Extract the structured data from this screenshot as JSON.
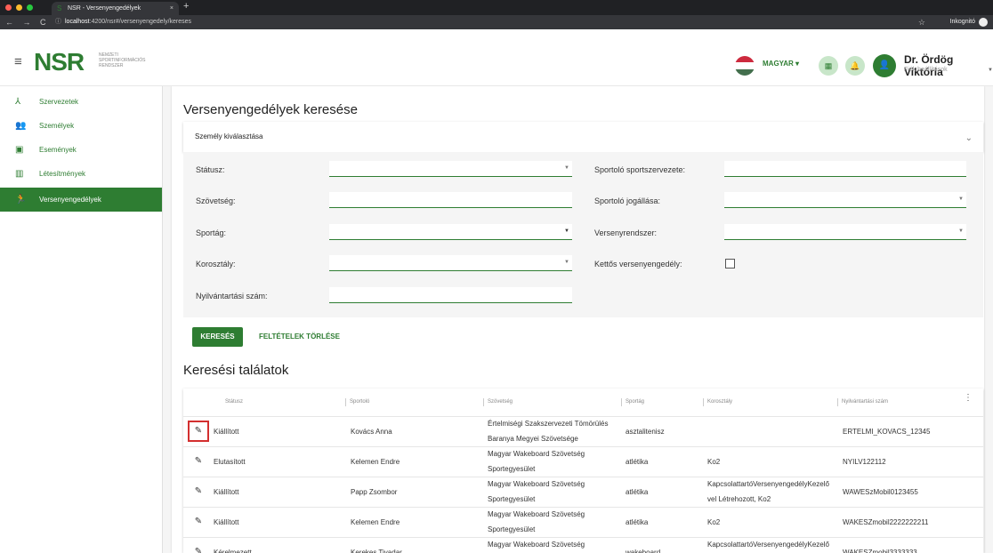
{
  "browser": {
    "tab_title": "NSR - Versenyengedélyek",
    "tab_close": "×",
    "new_tab": "+",
    "nav_icons": "← → C",
    "url_host": "localhost",
    "url_path": ":4200/nsr#/versenyengedely/kereses",
    "star": "☆",
    "incognito": "Inkognitó"
  },
  "header": {
    "menu": "≡",
    "logo": "NSR",
    "logo_sub_1": "Nemzeti",
    "logo_sub_2": "Sportinformációs",
    "logo_sub_3": "Rendszer",
    "language": "MAGYAR ▾",
    "user_name": "Dr. Ördög Viktória",
    "user_sub": "Fiók beállítások",
    "user_caret": "▼",
    "brand_color": "#2e7d32"
  },
  "sidebar": {
    "items": [
      {
        "label": "Szervezetek",
        "icon": "⅄"
      },
      {
        "label": "Személyek",
        "icon": "👥"
      },
      {
        "label": "Események",
        "icon": "▣"
      },
      {
        "label": "Létesítmények",
        "icon": "▥"
      },
      {
        "label": "Versenyengedélyek",
        "icon": "🏃"
      }
    ]
  },
  "main": {
    "page_title": "Versenyengedélyek keresése",
    "expander": "Személy kiválasztása",
    "expander_icon": "⌄",
    "form": {
      "status": "Státusz:",
      "federation": "Szövetség:",
      "sport": "Sportág:",
      "age_group": "Korosztály:",
      "reg_number": "Nyilvántartási szám:",
      "athlete_org": "Sportoló sportszervezete:",
      "athlete_status": "Sportoló jogállása:",
      "competition_system": "Versenyrendszer:",
      "dual_license": "Kettős versenyengedély:"
    },
    "search_button": "KERESÉS",
    "clear_button": "FELTÉTELEK TÖRLÉSE",
    "results_title": "Keresési találatok",
    "columns": [
      "Státusz",
      "Sportoló",
      "Szövetség",
      "Sportág",
      "Korosztály",
      "Nyilvántartási szám"
    ],
    "kebab": "⋮",
    "edit_icon": "✎",
    "rows": [
      {
        "status": "Kiállított",
        "athlete": "Kovács Anna",
        "fed1": "Értelmiségi Szakszervezeti Tömörülés",
        "fed2": "Baranya Megyei Szövetsége",
        "sport": "asztalitenisz",
        "age1": "",
        "age2": "",
        "reg": "ERTELMI_KOVACS_12345"
      },
      {
        "status": "Elutasított",
        "athlete": "Kelemen Endre",
        "fed1": "Magyar Wakeboard Szövetség",
        "fed2": "Sportegyesület",
        "sport": "atlétika",
        "age1": "Ko2",
        "age2": "",
        "reg": "NYILV122112"
      },
      {
        "status": "Kiállított",
        "athlete": "Papp Zsombor",
        "fed1": "Magyar Wakeboard Szövetség",
        "fed2": "Sportegyesület",
        "sport": "atlétika",
        "age1": "KapcsolattartóVersenyengedélyKezelő",
        "age2": "vel Létrehozott, Ko2",
        "reg": "WAWESzMobil0123455"
      },
      {
        "status": "Kiállított",
        "athlete": "Kelemen Endre",
        "fed1": "Magyar Wakeboard Szövetség",
        "fed2": "Sportegyesület",
        "sport": "atlétika",
        "age1": "Ko2",
        "age2": "",
        "reg": "WAKESZmobil2222222211"
      },
      {
        "status": "Kérelmezett",
        "athlete": "Kerekes Tivadar",
        "fed1": "Magyar Wakeboard Szövetség",
        "fed2": "",
        "sport": "wakeboard",
        "age1": "KapcsolattartóVersenyengedélyKezelő",
        "age2": "",
        "reg": "WAKESZmobil3333333"
      }
    ]
  }
}
